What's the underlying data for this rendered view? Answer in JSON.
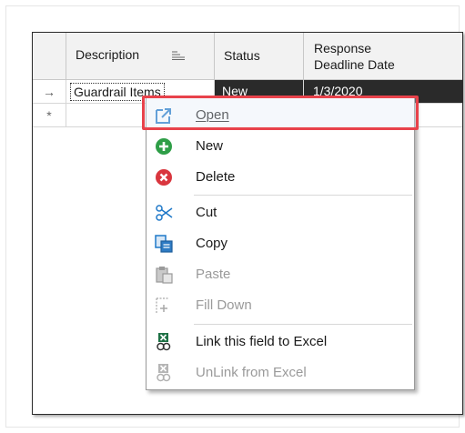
{
  "grid": {
    "columns": [
      {
        "label": "Description"
      },
      {
        "label": "Status"
      },
      {
        "label": "Response\nDeadline Date"
      }
    ],
    "rows": [
      {
        "indicator": "→",
        "description": "Guardrail Items",
        "status": "New",
        "deadline": "1/3/2020"
      },
      {
        "indicator": "*",
        "description": "",
        "status": "",
        "deadline": ""
      }
    ]
  },
  "context_menu": {
    "items": [
      {
        "label": "Open",
        "icon": "open-external-icon",
        "enabled": true,
        "underline": "O"
      },
      {
        "label": "New",
        "icon": "green-plus-icon",
        "enabled": true,
        "underline": "N"
      },
      {
        "label": "Delete",
        "icon": "red-x-icon",
        "enabled": true,
        "underline": "D"
      },
      {
        "label": "Cut",
        "icon": "scissors-icon",
        "enabled": true,
        "underline": "t"
      },
      {
        "label": "Copy",
        "icon": "copy-icon",
        "enabled": true,
        "underline": "y"
      },
      {
        "label": "Paste",
        "icon": "paste-icon",
        "enabled": false,
        "underline": "P"
      },
      {
        "label": "Fill Down",
        "icon": "fill-down-icon",
        "enabled": false,
        "underline": "F"
      },
      {
        "label": "Link this field to Excel",
        "icon": "excel-link-icon",
        "enabled": true,
        "underline": "L"
      },
      {
        "label": "UnLink from Excel",
        "icon": "excel-unlink-icon",
        "enabled": false,
        "underline": "U"
      }
    ]
  },
  "colors": {
    "highlight_border": "#e8424b",
    "selected_cell_bg": "#2a2a2a",
    "accent_blue": "#1f78c8",
    "excel_green": "#1e7145"
  }
}
